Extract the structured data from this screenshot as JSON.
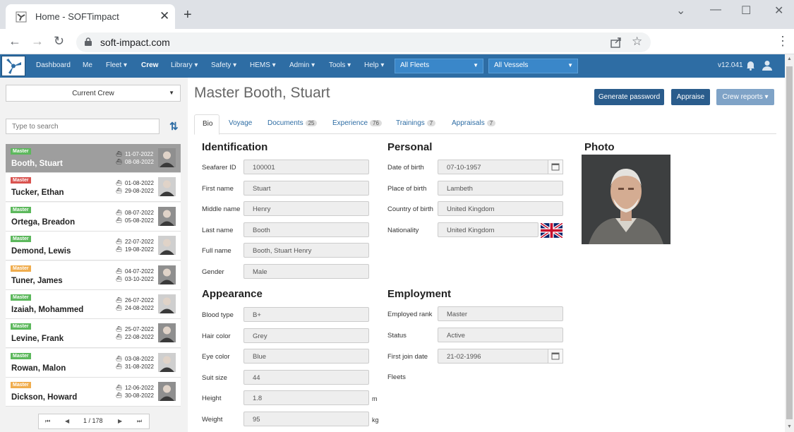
{
  "browser": {
    "tab_title": "Home - SOFTimpact",
    "url": "soft-impact.com",
    "close_symbol": "✕",
    "newtab_symbol": "+",
    "win_min": "⌄",
    "win_minimize": "—",
    "win_restore": "☐",
    "win_close": "✕",
    "back": "←",
    "forward": "→",
    "reload": "↻",
    "star": "☆",
    "menu": "⋮"
  },
  "nav": {
    "items": [
      "Dashboard",
      "Me",
      "Fleet ▾",
      "Crew",
      "Library ▾",
      "Safety ▾",
      "HEMS ▾",
      "Admin ▾",
      "Tools ▾",
      "Help ▾"
    ],
    "active": "Crew",
    "fleets_select": "All Fleets",
    "vessels_select": "All Vessels",
    "version": "v12.041"
  },
  "left": {
    "crew_select": "Current Crew",
    "search_placeholder": "Type to search",
    "sort_symbol": "⇅",
    "crew": [
      {
        "rank": "Master",
        "badge_color": "#5cb85c",
        "name": "Booth, Stuart",
        "date1": "11-07-2022",
        "date2": "08-08-2022",
        "selected": true
      },
      {
        "rank": "Master",
        "badge_color": "#d9534f",
        "name": "Tucker, Ethan",
        "date1": "01-08-2022",
        "date2": "29-08-2022",
        "selected": false
      },
      {
        "rank": "Master",
        "badge_color": "#5cb85c",
        "name": "Ortega, Breadon",
        "date1": "08-07-2022",
        "date2": "05-08-2022",
        "selected": false
      },
      {
        "rank": "Master",
        "badge_color": "#5cb85c",
        "name": "Demond, Lewis",
        "date1": "22-07-2022",
        "date2": "19-08-2022",
        "selected": false
      },
      {
        "rank": "Master",
        "badge_color": "#f0ad4e",
        "name": "Tuner, James",
        "date1": "04-07-2022",
        "date2": "03-10-2022",
        "selected": false
      },
      {
        "rank": "Master",
        "badge_color": "#5cb85c",
        "name": "Izaiah, Mohammed",
        "date1": "26-07-2022",
        "date2": "24-08-2022",
        "selected": false
      },
      {
        "rank": "Master",
        "badge_color": "#5cb85c",
        "name": "Levine, Frank",
        "date1": "25-07-2022",
        "date2": "22-08-2022",
        "selected": false
      },
      {
        "rank": "Master",
        "badge_color": "#5cb85c",
        "name": "Rowan, Malon",
        "date1": "03-08-2022",
        "date2": "31-08-2022",
        "selected": false
      },
      {
        "rank": "Master",
        "badge_color": "#f0ad4e",
        "name": "Dickson, Howard",
        "date1": "12-06-2022",
        "date2": "30-08-2022",
        "selected": false
      }
    ],
    "pager": {
      "first": "⏮",
      "prev": "◀",
      "page": "1 / 178",
      "next": "▶",
      "last": "⏭"
    }
  },
  "main": {
    "title": "Master Booth, Stuart",
    "buttons": {
      "generate": "Generate password",
      "appraise": "Appraise",
      "crew_reports": "Crew reports ▾"
    },
    "tabs": [
      {
        "label": "Bio",
        "count": ""
      },
      {
        "label": "Voyage",
        "count": ""
      },
      {
        "label": "Documents",
        "count": "25"
      },
      {
        "label": "Experience",
        "count": "76"
      },
      {
        "label": "Trainings",
        "count": "7"
      },
      {
        "label": "Appraisals",
        "count": "7"
      }
    ],
    "identification": {
      "heading": "Identification",
      "fields": [
        {
          "label": "Seafarer ID",
          "value": "100001"
        },
        {
          "label": "First name",
          "value": "Stuart"
        },
        {
          "label": "Middle name",
          "value": "Henry"
        },
        {
          "label": "Last name",
          "value": "Booth"
        },
        {
          "label": "Full name",
          "value": "Booth, Stuart Henry"
        },
        {
          "label": "Gender",
          "value": "Male"
        }
      ]
    },
    "personal": {
      "heading": "Personal",
      "fields": [
        {
          "label": "Date of birth",
          "value": "07-10-1957"
        },
        {
          "label": "Place of birth",
          "value": "Lambeth"
        },
        {
          "label": "Country of birth",
          "value": "United Kingdom"
        },
        {
          "label": "Nationality",
          "value": "United Kingdom"
        }
      ]
    },
    "photo_heading": "Photo",
    "appearance": {
      "heading": "Appearance",
      "fields": [
        {
          "label": "Blood type",
          "value": "B+",
          "unit": ""
        },
        {
          "label": "Hair color",
          "value": "Grey",
          "unit": ""
        },
        {
          "label": "Eye color",
          "value": "Blue",
          "unit": ""
        },
        {
          "label": "Suit size",
          "value": "44",
          "unit": ""
        },
        {
          "label": "Height",
          "value": "1.8",
          "unit": "m"
        },
        {
          "label": "Weight",
          "value": "95",
          "unit": "kg"
        }
      ]
    },
    "employment": {
      "heading": "Employment",
      "fields": [
        {
          "label": "Employed rank",
          "value": "Master"
        },
        {
          "label": "Status",
          "value": "Active"
        },
        {
          "label": "First join date",
          "value": "21-02-1996"
        },
        {
          "label": "Fleets",
          "value": ""
        }
      ]
    }
  }
}
